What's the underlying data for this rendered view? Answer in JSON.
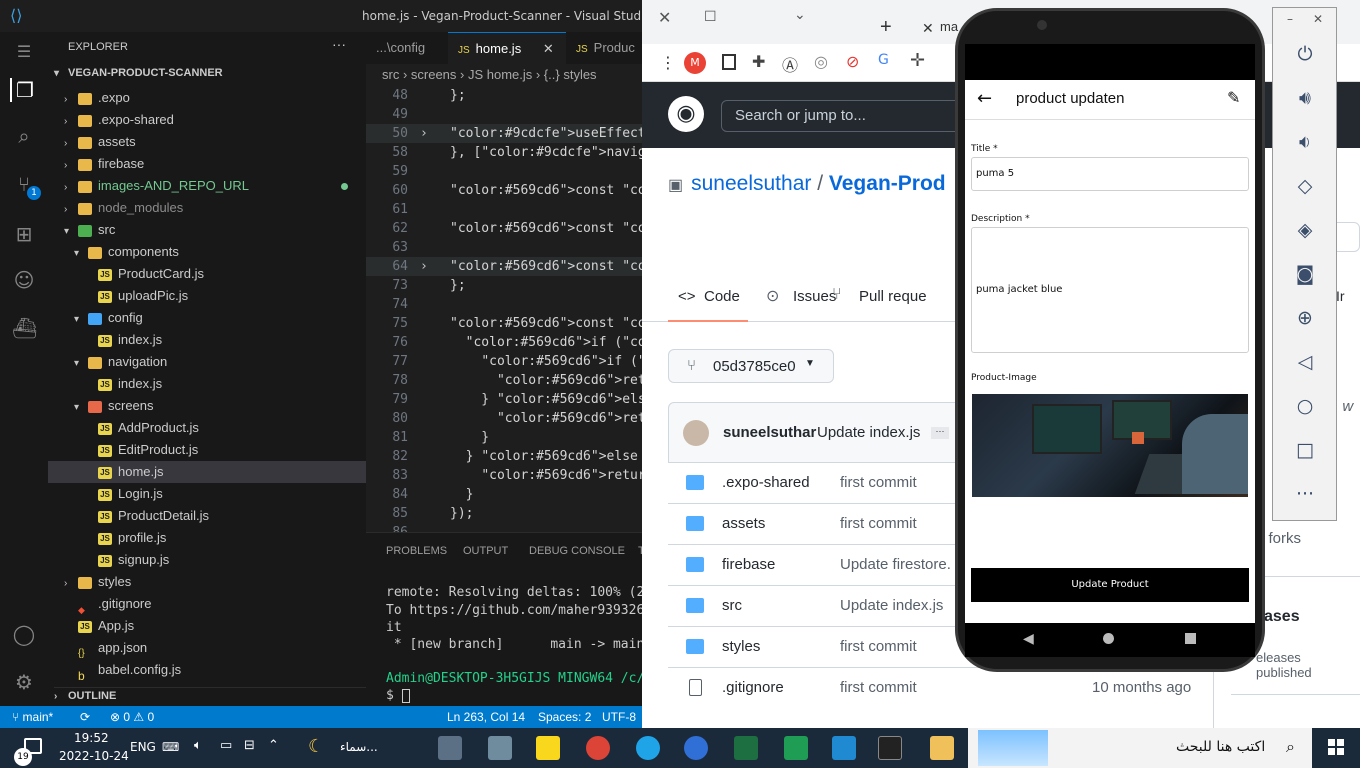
{
  "vscode": {
    "title": "home.js - Vegan-Product-Scanner - Visual Studio Code",
    "explorer_label": "EXPLORER",
    "project": "VEGAN-PRODUCT-SCANNER",
    "tree": [
      {
        "label": ".expo",
        "type": "folder",
        "depth": 1,
        "color": "#cccccc"
      },
      {
        "label": ".expo-shared",
        "type": "folder",
        "depth": 1,
        "color": "#cccccc"
      },
      {
        "label": "assets",
        "type": "folder",
        "depth": 1,
        "color": "#cccccc"
      },
      {
        "label": "firebase",
        "type": "folder",
        "depth": 1,
        "color": "#cccccc"
      },
      {
        "label": "images-AND_REPO_URL",
        "type": "folder",
        "depth": 1,
        "color": "#73c991"
      },
      {
        "label": "node_modules",
        "type": "folder",
        "depth": 1,
        "color": "#8b8b8b"
      },
      {
        "label": "src",
        "type": "folder-open",
        "depth": 1,
        "color": "#cccccc"
      },
      {
        "label": "components",
        "type": "folder-open",
        "depth": 2,
        "color": "#cccccc"
      },
      {
        "label": "ProductCard.js",
        "type": "js",
        "depth": 3,
        "color": "#cccccc"
      },
      {
        "label": "uploadPic.js",
        "type": "js",
        "depth": 3,
        "color": "#cccccc"
      },
      {
        "label": "config",
        "type": "folder-open",
        "depth": 2,
        "color": "#cccccc"
      },
      {
        "label": "index.js",
        "type": "js",
        "depth": 3,
        "color": "#cccccc"
      },
      {
        "label": "navigation",
        "type": "folder-open",
        "depth": 2,
        "color": "#cccccc"
      },
      {
        "label": "index.js",
        "type": "js",
        "depth": 3,
        "color": "#cccccc"
      },
      {
        "label": "screens",
        "type": "folder-open",
        "depth": 2,
        "color": "#cccccc"
      },
      {
        "label": "AddProduct.js",
        "type": "js",
        "depth": 3,
        "color": "#cccccc"
      },
      {
        "label": "EditProduct.js",
        "type": "js",
        "depth": 3,
        "color": "#cccccc"
      },
      {
        "label": "home.js",
        "type": "js",
        "depth": 3,
        "color": "#cccccc",
        "selected": true
      },
      {
        "label": "Login.js",
        "type": "js",
        "depth": 3,
        "color": "#cccccc"
      },
      {
        "label": "ProductDetail.js",
        "type": "js",
        "depth": 3,
        "color": "#cccccc"
      },
      {
        "label": "profile.js",
        "type": "js",
        "depth": 3,
        "color": "#cccccc"
      },
      {
        "label": "signup.js",
        "type": "js",
        "depth": 3,
        "color": "#cccccc"
      },
      {
        "label": "styles",
        "type": "folder",
        "depth": 1,
        "color": "#cccccc"
      },
      {
        "label": ".gitignore",
        "type": "file",
        "depth": 1,
        "color": "#cccccc"
      },
      {
        "label": "App.js",
        "type": "js",
        "depth": 1,
        "color": "#cccccc"
      },
      {
        "label": "app.json",
        "type": "json",
        "depth": 1,
        "color": "#cccccc"
      },
      {
        "label": "babel.config.js",
        "type": "babel",
        "depth": 1,
        "color": "#cccccc"
      }
    ],
    "outline": "OUTLINE",
    "tabs": [
      {
        "label": "...\\config",
        "active": false
      },
      {
        "label": "home.js",
        "active": true
      },
      {
        "label": "Produc",
        "active": false
      }
    ],
    "breadcrumb": "src › screens › JS home.js › {..} styles",
    "code": [
      {
        "n": "48",
        "text": "};",
        "fold": false
      },
      {
        "n": "49",
        "text": "",
        "fold": false
      },
      {
        "n": "50",
        "text": "useEffect(() => {…",
        "fold": true
      },
      {
        "n": "58",
        "text": "}, [navigation]);",
        "fold": false
      },
      {
        "n": "59",
        "text": "",
        "fold": false
      },
      {
        "n": "60",
        "text": "const openMenu = () => se",
        "fold": false
      },
      {
        "n": "61",
        "text": "",
        "fold": false
      },
      {
        "n": "62",
        "text": "const closeMenu = () => s",
        "fold": false
      },
      {
        "n": "63",
        "text": "",
        "fold": false
      },
      {
        "n": "64",
        "text": "const Logout = () => {…",
        "fold": true
      },
      {
        "n": "73",
        "text": "};",
        "fold": false
      },
      {
        "n": "74",
        "text": "",
        "fold": false
      },
      {
        "n": "75",
        "text": "const filteredData = prod",
        "fold": false
      },
      {
        "n": "76",
        "text": "  if (products.length !==",
        "fold": false
      },
      {
        "n": "77",
        "text": "    if (search !== \"\") {",
        "fold": false
      },
      {
        "n": "78",
        "text": "      return data.title.t",
        "fold": false
      },
      {
        "n": "79",
        "text": "    } else {",
        "fold": false
      },
      {
        "n": "80",
        "text": "      return products;",
        "fold": false
      },
      {
        "n": "81",
        "text": "    }",
        "fold": false
      },
      {
        "n": "82",
        "text": "  } else {",
        "fold": false
      },
      {
        "n": "83",
        "text": "    return products;",
        "fold": false
      },
      {
        "n": "84",
        "text": "  }",
        "fold": false
      },
      {
        "n": "85",
        "text": "});",
        "fold": false
      },
      {
        "n": "86",
        "text": "",
        "fold": false
      }
    ],
    "panel_tabs": [
      "PROBLEMS",
      "OUTPUT",
      "DEBUG CONSOLE",
      "T"
    ],
    "terminal": [
      "remote: Resolving deltas: 100% (2/2),",
      "To https://github.com/maher9393267111",
      "it",
      " * [new branch]      main -> main",
      "",
      "Admin@DESKTOP-3H5GIJS MINGW64 /c/proj",
      "$ "
    ],
    "status": {
      "branch": "main*",
      "errors": "0",
      "warnings": "0",
      "position": "Ln 263, Col 14",
      "spaces": "Spaces: 2",
      "encoding": "UTF-8"
    }
  },
  "browser": {
    "tab_label": "ma",
    "search_placeholder": "Search or jump to...",
    "owner": "suneelsuthar",
    "sep": "/",
    "repo": "Vegan-Prod",
    "tabs": [
      "Code",
      "Issues",
      "Pull reque"
    ],
    "branch": "05d3785ce0",
    "commit_author": "suneelsuthar",
    "commit_msg": "Update index.js",
    "files": [
      {
        "name": ".expo-shared",
        "msg": "first commit",
        "date": "",
        "type": "folder"
      },
      {
        "name": "assets",
        "msg": "first commit",
        "date": "",
        "type": "folder"
      },
      {
        "name": "firebase",
        "msg": "Update firestore.",
        "date": "",
        "type": "folder"
      },
      {
        "name": "src",
        "msg": "Update index.js",
        "date": "",
        "type": "folder"
      },
      {
        "name": "styles",
        "msg": "first commit",
        "date": "",
        "type": "folder"
      },
      {
        "name": ".gitignore",
        "msg": "first commit",
        "date": "10 months ago",
        "type": "file"
      }
    ],
    "right_fragments": {
      "forks": "0 forks",
      "releases": "ases",
      "no_releases": "eleases published",
      "r1": "ct",
      "r2": "Ir",
      "r3": "le",
      "r4": ", w",
      "r5": "i"
    }
  },
  "phone": {
    "header_title": "product updaten",
    "title_label": "Title *",
    "title_value": "puma  5",
    "description_label": "Description *",
    "description_value": "puma jacket blue",
    "image_label": "Product-Image",
    "button_label": "Update Product"
  },
  "taskbar": {
    "time": "19:52",
    "date": "2022-10-24",
    "lang": "ENG",
    "weather": "سماء...",
    "search": "اكتب هنا للبحث",
    "notif": "19"
  }
}
